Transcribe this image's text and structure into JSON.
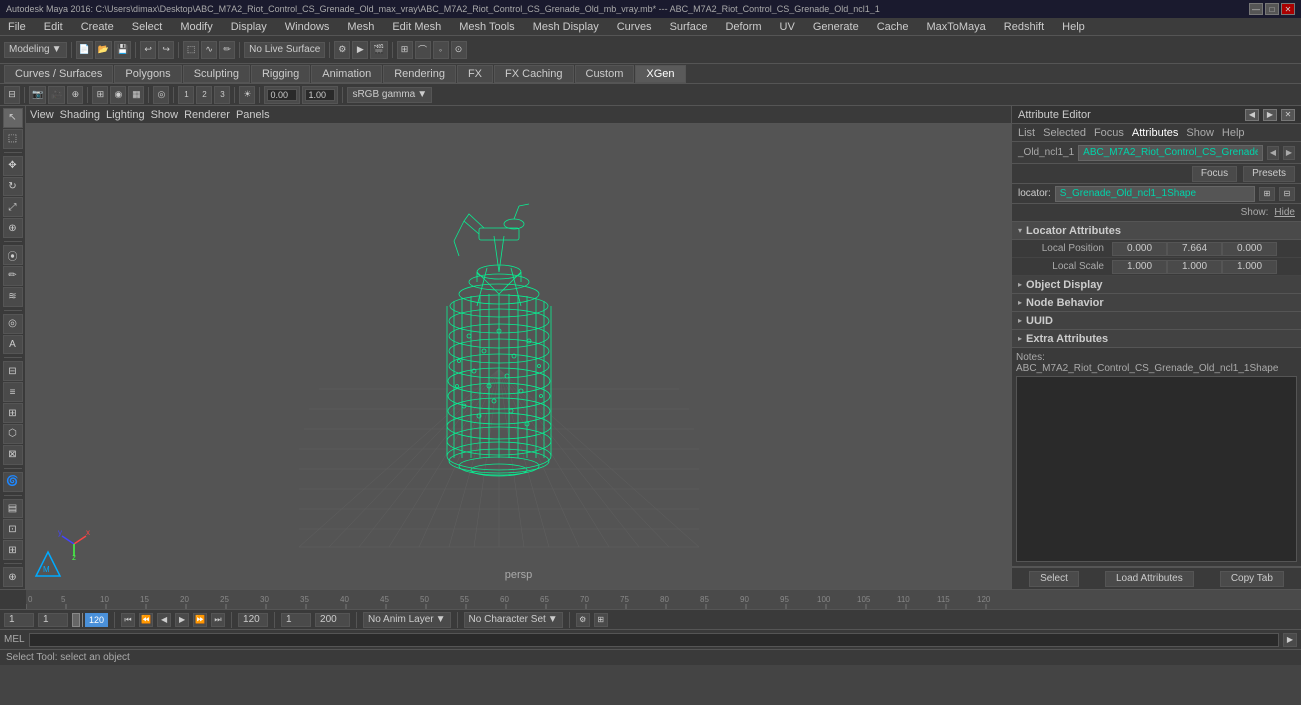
{
  "titleBar": {
    "title": "Autodesk Maya 2016: C:\\Users\\dimax\\Desktop\\ABC_M7A2_Riot_Control_CS_Grenade_Old_max_vray\\ABC_M7A2_Riot_Control_CS_Grenade_Old_mb_vray.mb* --- ABC_M7A2_Riot_Control_CS_Grenade_Old_ncl1_1",
    "minimizeLabel": "—",
    "maximizeLabel": "□",
    "closeLabel": "✕"
  },
  "menuBar": {
    "items": [
      "File",
      "Edit",
      "Create",
      "Select",
      "Modify",
      "Display",
      "Windows",
      "Mesh",
      "Edit Mesh",
      "Mesh Tools",
      "Mesh Display",
      "Curves",
      "Surface",
      "Deform",
      "UV",
      "Generate",
      "Cache",
      "MaxToMaya",
      "Redshift",
      "Help"
    ]
  },
  "toolbar1": {
    "mode": "Modeling",
    "noLiveSurface": "No Live Surface"
  },
  "tabBar": {
    "tabs": [
      "Curves / Surfaces",
      "Polygons",
      "Sculpting",
      "Rigging",
      "Animation",
      "Rendering",
      "FX",
      "FX Caching",
      "Custom",
      "XGen"
    ],
    "activeTab": "XGen"
  },
  "viewport": {
    "label": "persp",
    "menus": [
      "View",
      "Shading",
      "Lighting",
      "Show",
      "Renderer",
      "Panels"
    ],
    "colorSpace": "sRGB gamma",
    "focalValue": "0.00",
    "scaleValue": "1.00"
  },
  "attributeEditor": {
    "title": "Attribute Editor",
    "tabs": [
      "List",
      "Selected",
      "Focus",
      "Attributes",
      "Show",
      "Help"
    ],
    "nodeName": "_Old_ncl1_1",
    "nodeShape": "ABC_M7A2_Riot_Control_CS_Grenade_Old_ncl1_1Shape",
    "focusBtn": "Focus",
    "presetsBtn": "Presets",
    "showLabel": "Show:",
    "hideLabel": "Hide",
    "locatorLabel": "locator:",
    "locatorValue": "S_Grenade_Old_ncl1_1Shape",
    "sections": {
      "locatorAttributes": {
        "title": "Locator Attributes",
        "expanded": true,
        "rows": [
          {
            "label": "Local Position",
            "values": [
              "0.000",
              "7.664",
              "0.000"
            ]
          },
          {
            "label": "Local Scale",
            "values": [
              "1.000",
              "1.000",
              "1.000"
            ]
          }
        ]
      },
      "objectDisplay": {
        "title": "Object Display",
        "expanded": false
      },
      "nodeBehavior": {
        "title": "Node Behavior",
        "expanded": false
      },
      "uuid": {
        "title": "UUID",
        "expanded": false
      },
      "extraAttributes": {
        "title": "Extra Attributes",
        "expanded": false
      }
    },
    "notes": {
      "label": "Notes: ABC_M7A2_Riot_Control_CS_Grenade_Old_ncl1_1Shape",
      "content": ""
    },
    "bottomButtons": [
      "Select",
      "Load Attributes",
      "Copy Tab"
    ]
  },
  "timeline": {
    "ticks": [
      0,
      5,
      10,
      15,
      20,
      25,
      30,
      35,
      40,
      45,
      50,
      55,
      60,
      65,
      70,
      75,
      80,
      85,
      90,
      95,
      100,
      105,
      110,
      115,
      120
    ],
    "currentFrame": "1",
    "startFrame": "1",
    "endFrame": "120",
    "minFrame": "1",
    "maxFrame": "200"
  },
  "bottomBar": {
    "animLayer": "No Anim Layer",
    "characterSet": "No Character Set",
    "melLabel": "MEL",
    "statusText": "Select Tool: select an object"
  },
  "icons": {
    "arrow": "↖",
    "move": "✥",
    "rotate": "↻",
    "scale": "⤢",
    "select": "▶",
    "play": "▶",
    "pause": "⏸",
    "skipStart": "⏮",
    "skipEnd": "⏭",
    "stepBack": "◀",
    "stepForward": "▶",
    "chevronDown": "▼",
    "chevronRight": "▶",
    "chevronLeft": "◀",
    "expand": "▸",
    "collapse": "▾"
  }
}
